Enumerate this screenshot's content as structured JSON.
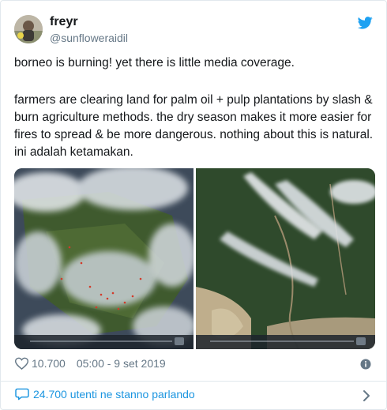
{
  "tweet": {
    "display_name": "freyr",
    "handle": "@sunfloweraidil",
    "paragraphs": [
      "borneo is burning! yet there is little media coverage.",
      "farmers are clearing land for palm oil + pulp plantations by slash & burn agriculture methods. the dry season makes it more easier for fires to spread & be more dangerous. nothing about this is natural. ini adalah ketamakan."
    ],
    "likes": "10.700",
    "timestamp": "05:00 - 9 set 2019",
    "conversation": "24.700 utenti ne stanno parlando"
  },
  "icons": {
    "platform": "twitter-bird-icon",
    "like": "heart-icon",
    "info": "info-icon",
    "conversation": "speech-bubble-icon",
    "more": "chevron-right-icon"
  },
  "colors": {
    "link": "#1b95e0",
    "muted": "#657786",
    "text": "#14171a",
    "twitter_blue": "#1da1f2",
    "border": "#e1e8ed"
  }
}
